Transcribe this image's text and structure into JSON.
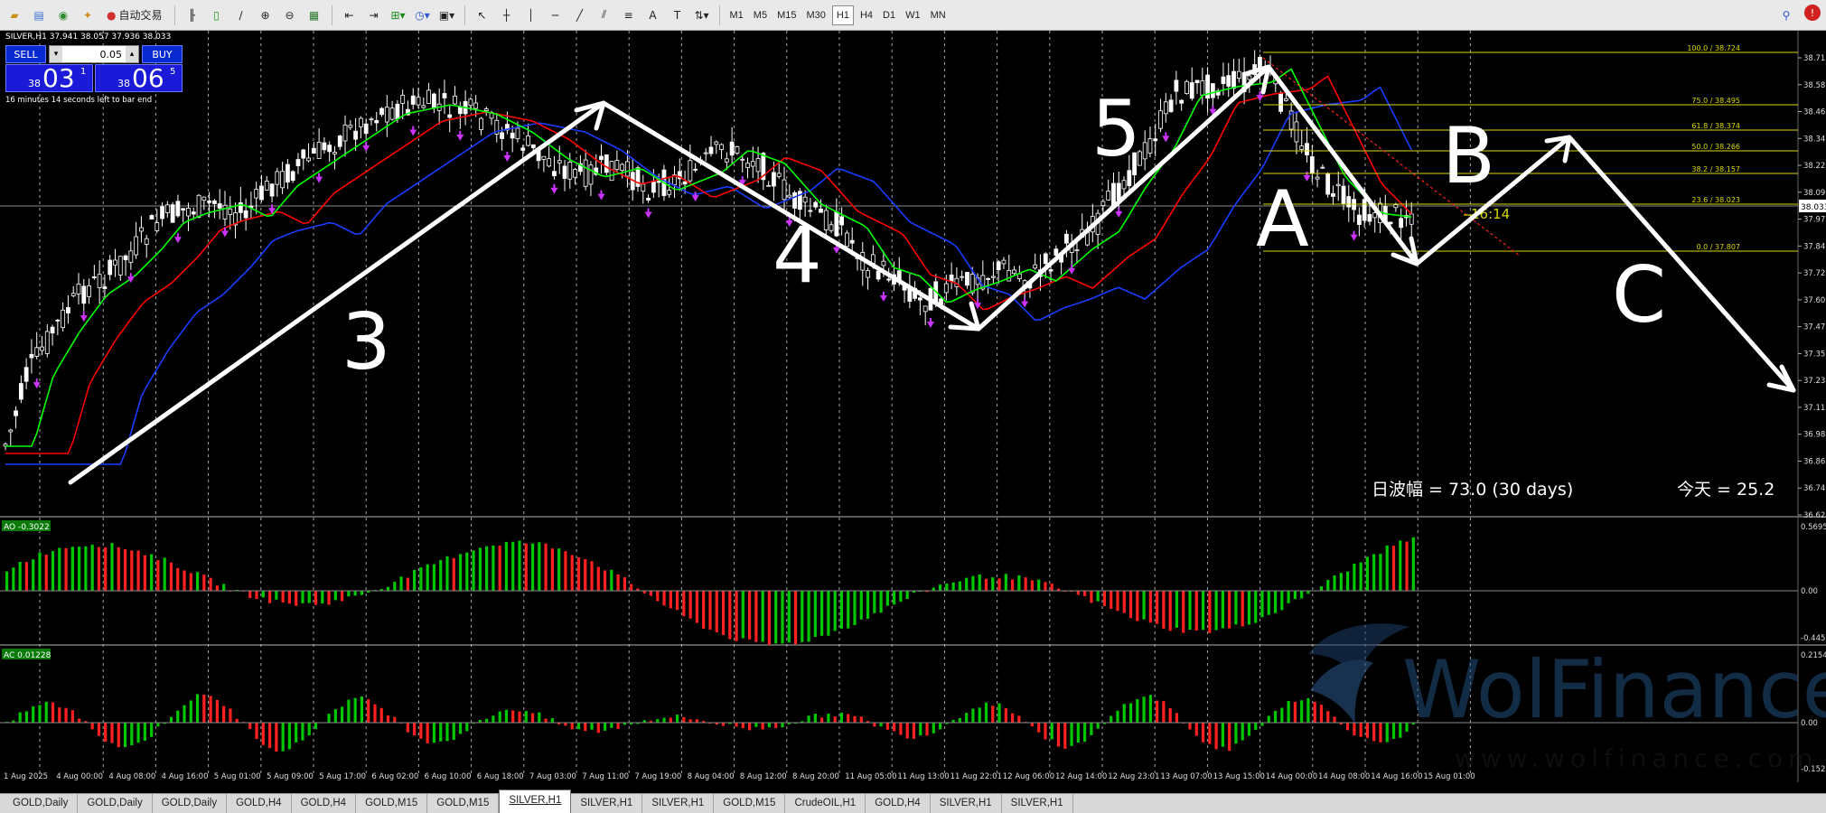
{
  "toolbar": {
    "autotrade_label": "自动交易",
    "timeframes": [
      "M1",
      "M5",
      "M15",
      "M30",
      "H1",
      "H4",
      "D1",
      "W1",
      "MN"
    ],
    "active_timeframe": "H1"
  },
  "chart": {
    "symbol_header": "SILVER,H1  37.941 38.057 37.936 38.033",
    "trade_panel": {
      "sell_label": "SELL",
      "buy_label": "BUY",
      "lot": "0.05",
      "bid_small": "38",
      "bid_big": "03",
      "bid_sup": "1",
      "ask_small": "38",
      "ask_big": "06",
      "ask_sup": "5",
      "countdown_note": "16 minutes 14 seconds left to bar end"
    },
    "price_labels": [
      "38.710",
      "38.585",
      "38.465",
      "38.340",
      "38.220",
      "38.095",
      "37.970",
      "37.845",
      "37.720",
      "37.600",
      "37.475",
      "37.355",
      "37.230",
      "37.110",
      "36.985",
      "36.865",
      "36.740",
      "36.620"
    ],
    "current_price_tag": "38.033",
    "fibonacci": [
      {
        "label": "100.0 / 38.724"
      },
      {
        "label": "75.0 / 38.495"
      },
      {
        "label": "61.8 / 38.374"
      },
      {
        "label": "50.0 / 38.266"
      },
      {
        "label": "38.2 / 38.157"
      },
      {
        "label": "23.6 / 38.023"
      },
      {
        "label": "0.0 / 37.807"
      }
    ],
    "bar_countdown": "16:14",
    "wave_labels": [
      "3",
      "4",
      "5",
      "A",
      "B",
      "C"
    ],
    "daily_range_text": "日波幅 = 73.0  (30 days)",
    "today_text": "今天 = 25.2",
    "time_labels": [
      "1 Aug 2025",
      "4 Aug 00:00",
      "4 Aug 08:00",
      "4 Aug 16:00",
      "5 Aug 01:00",
      "5 Aug 09:00",
      "5 Aug 17:00",
      "6 Aug 02:00",
      "6 Aug 10:00",
      "6 Aug 18:00",
      "7 Aug 03:00",
      "7 Aug 11:00",
      "7 Aug 19:00",
      "8 Aug 04:00",
      "8 Aug 12:00",
      "8 Aug 20:00",
      "11 Aug 05:00",
      "11 Aug 13:00",
      "11 Aug 22:01",
      "12 Aug 06:00",
      "12 Aug 14:00",
      "12 Aug 23:01",
      "13 Aug 07:00",
      "13 Aug 15:00",
      "14 Aug 00:00",
      "14 Aug 08:00",
      "14 Aug 16:00",
      "15 Aug 01:00"
    ]
  },
  "ao": {
    "label": "AO -0.3022",
    "scale_top": "0.5695",
    "scale_zero": "0.00",
    "scale_bottom": "-0.4455"
  },
  "ac": {
    "label": "AC 0.01228",
    "scale_top": "0.2154",
    "scale_zero": "0.00",
    "scale_bottom": "-0.1527"
  },
  "watermark": {
    "brand": "WolFinance",
    "url": "www.wolfinance.com"
  },
  "tabs": [
    "GOLD,Daily",
    "GOLD,Daily",
    "GOLD,Daily",
    "GOLD,H4",
    "GOLD,H4",
    "GOLD,M15",
    "GOLD,M15",
    "SILVER,H1",
    "SILVER,H1",
    "SILVER,H1",
    "GOLD,M15",
    "CrudeOIL,H1",
    "GOLD,H4",
    "SILVER,H1",
    "SILVER,H1"
  ],
  "active_tab_index": 7,
  "colors": {
    "bull": "#00c800",
    "bear": "#ff2020",
    "ma_fast": "#00ff00",
    "ma_mid": "#ff0000",
    "ma_slow": "#1a3cff",
    "fib": "#d8d800",
    "arrows": "#cc33ff"
  }
}
